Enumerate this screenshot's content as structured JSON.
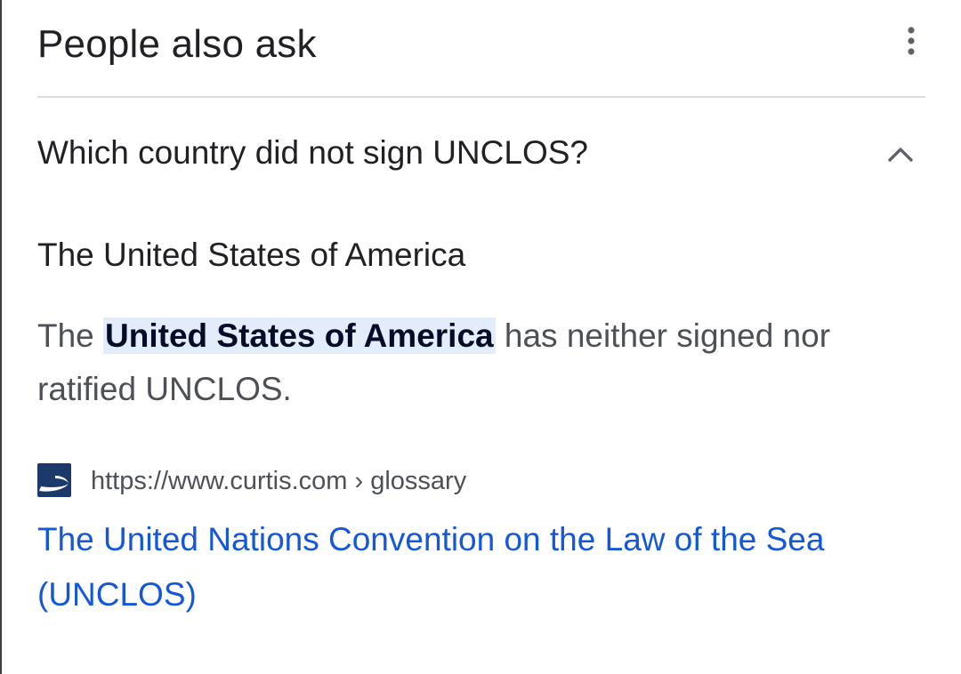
{
  "paa": {
    "title": "People also ask",
    "more_icon": "more-vert-icon",
    "question": "Which country did not sign UNCLOS?",
    "expand_icon": "chevron-up-icon",
    "answer_title": "The United States of America",
    "snippet": {
      "before": "The ",
      "highlight": "United States of America",
      "after": " has neither signed nor ratified UNCLOS."
    },
    "source": {
      "favicon_icon": "curtis-favicon-icon",
      "url": "https://www.curtis.com › glossary"
    },
    "result_link": "The United Nations Convention on the Law of the Sea (UNCLOS)"
  },
  "colors": {
    "text": "#202124",
    "secondary_text": "#4d5156",
    "link": "#1558d6",
    "highlight_bg": "#e2ecfb",
    "divider": "#dadce0"
  }
}
